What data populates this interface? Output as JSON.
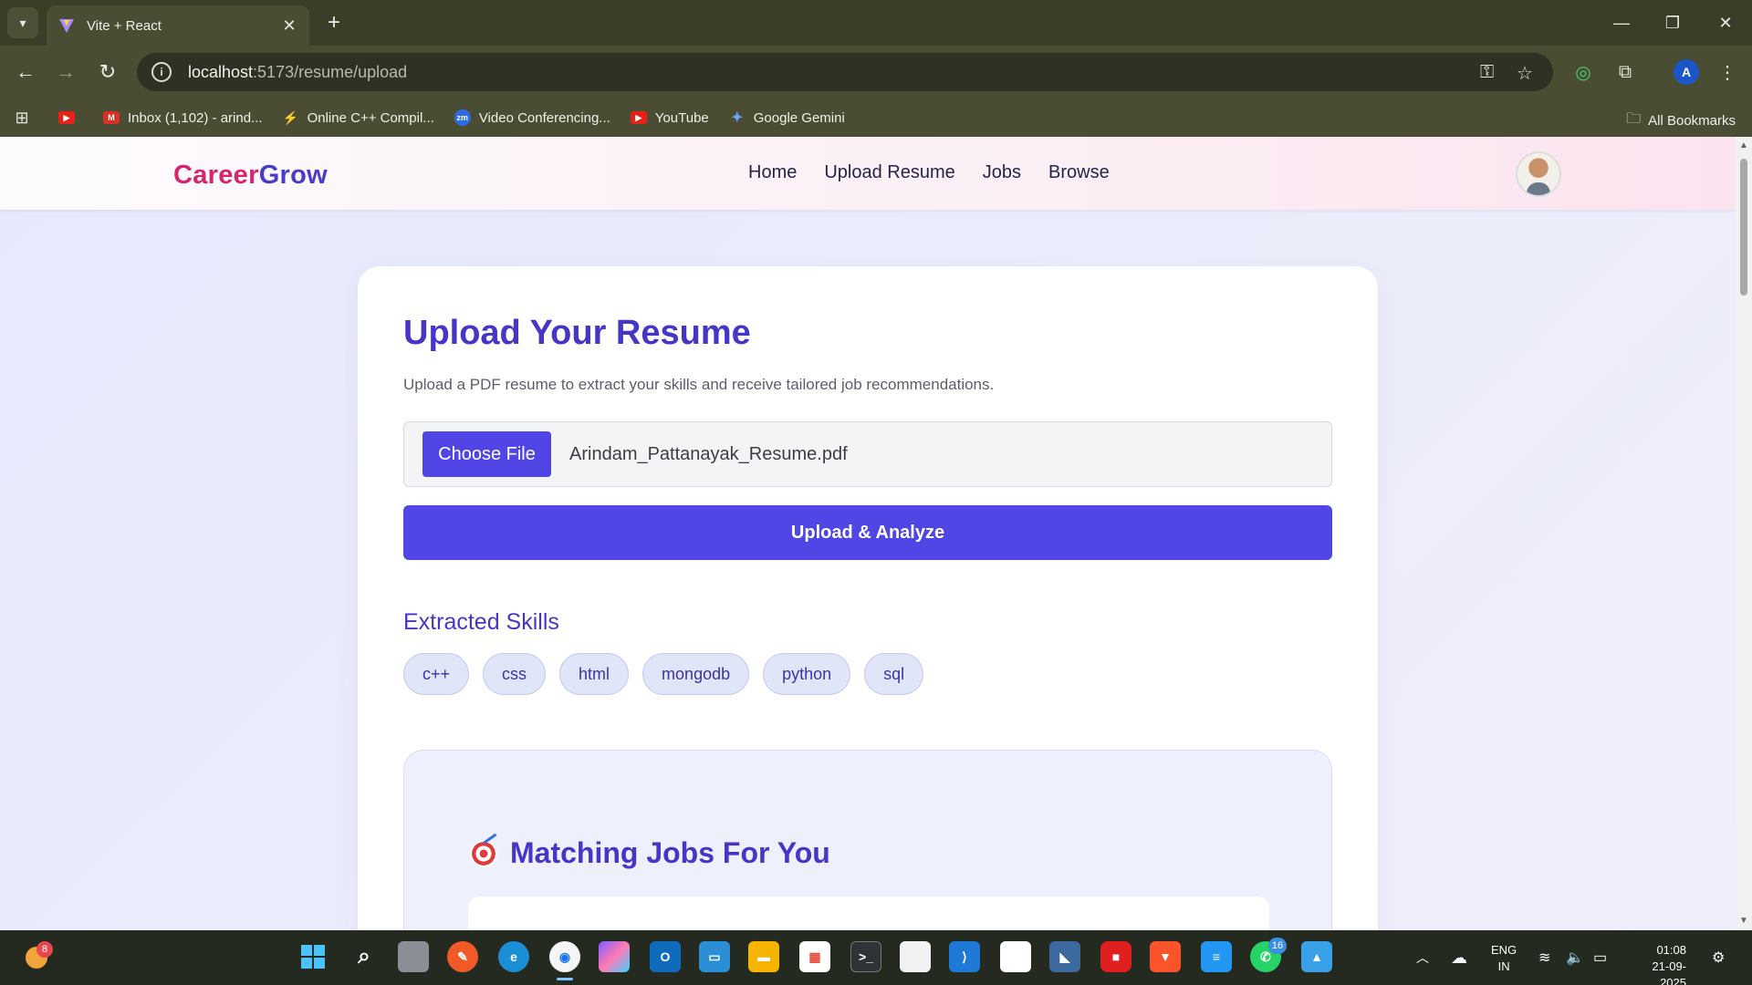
{
  "browser": {
    "tab_title": "Vite + React",
    "url_host": "localhost",
    "url_path": ":5173/resume/upload",
    "bookmarks": [
      {
        "label": "",
        "icon": "youtube-icon",
        "color": "#e62117"
      },
      {
        "label": "Inbox (1,102) - arind...",
        "icon": "gmail-icon",
        "color": "#d93025"
      },
      {
        "label": "Online C++ Compil...",
        "icon": "bolt-icon",
        "color": "#6b46e5"
      },
      {
        "label": "Video Conferencing...",
        "icon": "zoom-icon",
        "color": "#2d6be5"
      },
      {
        "label": "YouTube",
        "icon": "youtube-icon",
        "color": "#e62117"
      },
      {
        "label": "Google Gemini",
        "icon": "gemini-icon",
        "color": "#4b8bf5"
      }
    ],
    "all_bookmarks": "All Bookmarks"
  },
  "navbar": {
    "brand_part1": "Career",
    "brand_part2": "Grow",
    "links": [
      "Home",
      "Upload Resume",
      "Jobs",
      "Browse"
    ]
  },
  "upload": {
    "title": "Upload Your Resume",
    "subtitle": "Upload a PDF resume to extract your skills and receive tailored job recommendations.",
    "choose_label": "Choose File",
    "file_name": "Arindam_Pattanayak_Resume.pdf",
    "upload_label": "Upload & Analyze"
  },
  "skills": {
    "title": "Extracted Skills",
    "items": [
      "c++",
      "css",
      "html",
      "mongodb",
      "python",
      "sql"
    ]
  },
  "jobs": {
    "title": "Matching Jobs For You"
  },
  "taskbar": {
    "weather_badge": "8",
    "whatsapp_badge": "16",
    "lang_line1": "ENG",
    "lang_line2": "IN",
    "time": "01:08",
    "date": "21-09-2025"
  },
  "colors": {
    "accent": "#4f46e5",
    "brand_pink": "#d6246e",
    "heading": "#4636c8"
  }
}
